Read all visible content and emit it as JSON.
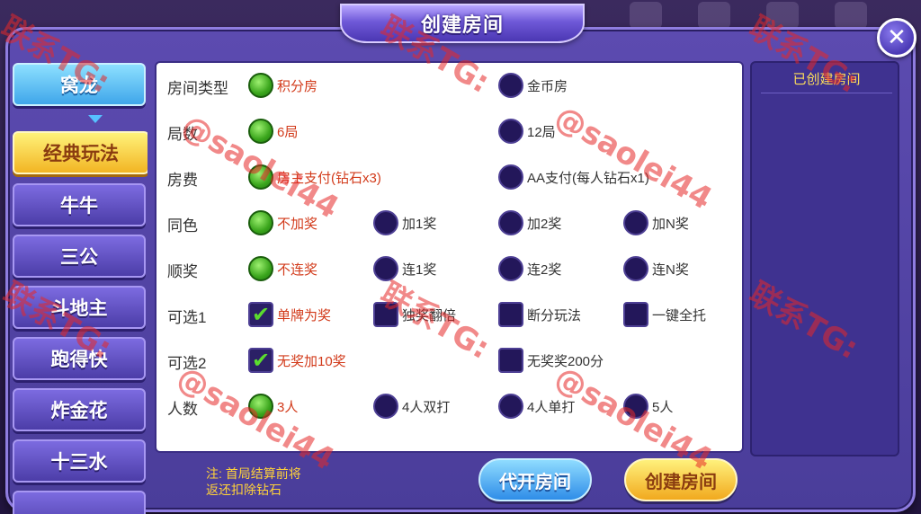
{
  "dialog": {
    "title": "创建房间",
    "close_label": "✕"
  },
  "menu": {
    "items": [
      {
        "label": "窝龙"
      },
      {
        "label": "经典玩法"
      },
      {
        "label": "牛牛"
      },
      {
        "label": "三公"
      },
      {
        "label": "斗地主"
      },
      {
        "label": "跑得快"
      },
      {
        "label": "炸金花"
      },
      {
        "label": "十三水"
      }
    ]
  },
  "options": {
    "rows": [
      {
        "label": "房间类型",
        "choices": [
          {
            "text": "积分房",
            "selected": true
          },
          {
            "text": "金币房",
            "selected": false
          }
        ]
      },
      {
        "label": "局数",
        "choices": [
          {
            "text": "6局",
            "selected": true
          },
          {
            "text": "12局",
            "selected": false
          }
        ]
      },
      {
        "label": "房费",
        "choices": [
          {
            "text": "房主支付(钻石x3)",
            "selected": true
          },
          {
            "text": "AA支付(每人钻石x1)",
            "selected": false
          }
        ]
      },
      {
        "label": "同色",
        "choices": [
          {
            "text": "不加奖",
            "selected": true
          },
          {
            "text": "加1奖",
            "selected": false
          },
          {
            "text": "加2奖",
            "selected": false
          },
          {
            "text": "加N奖",
            "selected": false
          }
        ]
      },
      {
        "label": "顺奖",
        "choices": [
          {
            "text": "不连奖",
            "selected": true
          },
          {
            "text": "连1奖",
            "selected": false
          },
          {
            "text": "连2奖",
            "selected": false
          },
          {
            "text": "连N奖",
            "selected": false
          }
        ]
      },
      {
        "label": "可选1",
        "choices": [
          {
            "text": "单牌为奖",
            "selected": true
          },
          {
            "text": "独奖翻倍",
            "selected": false
          },
          {
            "text": "断分玩法",
            "selected": false
          },
          {
            "text": "一键全托",
            "selected": false
          }
        ]
      },
      {
        "label": "可选2",
        "choices": [
          {
            "text": "无奖加10奖",
            "selected": true
          },
          {
            "text": "无奖奖200分",
            "selected": false
          }
        ]
      },
      {
        "label": "人数",
        "choices": [
          {
            "text": "3人",
            "selected": true
          },
          {
            "text": "4人双打",
            "selected": false
          },
          {
            "text": "4人单打",
            "selected": false
          },
          {
            "text": "5人",
            "selected": false
          }
        ]
      }
    ]
  },
  "right_panel": {
    "title": "已创建房间"
  },
  "footer": {
    "note_line1": "注: 首局结算前将",
    "note_line2": "返还扣除钻石",
    "proxy_button": "代开房间",
    "create_button": "创建房间"
  },
  "watermark": {
    "contact": "联系TG:",
    "handle": "@saolei44"
  },
  "colors": {
    "dialog_bg": "#5c4bb0",
    "selected_text": "#d23a1a",
    "radio_on": "#3aa51c",
    "note_text": "#ffd23a",
    "watermark": "#e62828"
  }
}
